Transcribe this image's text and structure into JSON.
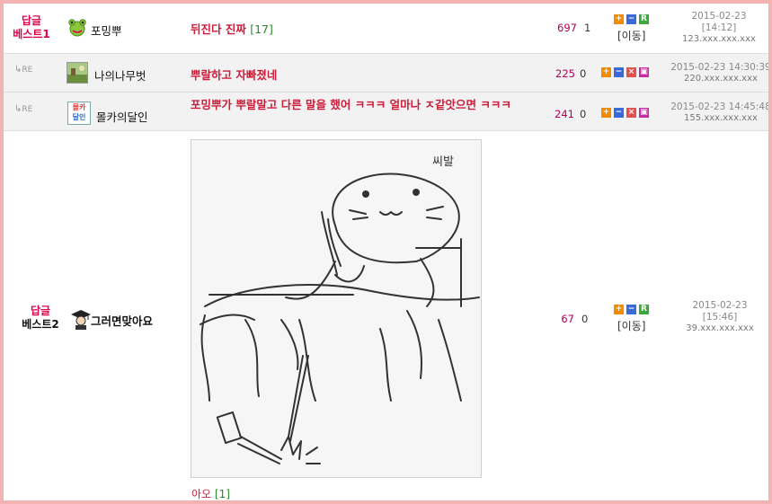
{
  "rows": [
    {
      "badge_line1": "답글",
      "badge_line2": "베스트1",
      "nick": "포밍뿌",
      "subject": "뒤진다 진짜",
      "comments": "[17]",
      "views": "697",
      "recommend": "1",
      "move": "[이동]",
      "date": "2015-02-23",
      "time": "[14:12]",
      "ip": "123.xxx.xxx.xxx"
    },
    {
      "re": "RE",
      "nick": "나의나무벗",
      "subject": "뿌랄하고 자빠졌네",
      "views": "225",
      "recommend": "0",
      "datetime": "2015-02-23 14:30:39",
      "ip": "220.xxx.xxx.xxx"
    },
    {
      "re": "RE",
      "nick": "몰카의달인",
      "avatar_text": [
        "몰카",
        "달인"
      ],
      "subject": "포밍뿌가 뿌랄말고 다른 말을 했어 ㅋㅋㅋ 얼마나 ㅈ같앗으면 ㅋㅋㅋ",
      "views": "241",
      "recommend": "0",
      "datetime": "2015-02-23 14:45:48",
      "ip": "155.xxx.xxx.xxx"
    },
    {
      "badge_line1": "답글",
      "badge_line2": "베스트2",
      "nick": "그러면맞아요",
      "views": "67",
      "recommend": "0",
      "move": "[이동]",
      "date": "2015-02-23",
      "time": "[15:46]",
      "ip": "39.xxx.xxx.xxx",
      "image_text": "씨발",
      "caption": "아오",
      "caption_count": "[1]"
    }
  ],
  "icons": {
    "plus": "+",
    "minus": "−",
    "recommend": "R",
    "delete": "×",
    "print": "▣"
  },
  "colors": {
    "border": "#f3b3b3",
    "badge": "#e0004a",
    "subject": "#cc1d3a",
    "views": "#b0005a",
    "comment_count": "#2a8a2a"
  }
}
